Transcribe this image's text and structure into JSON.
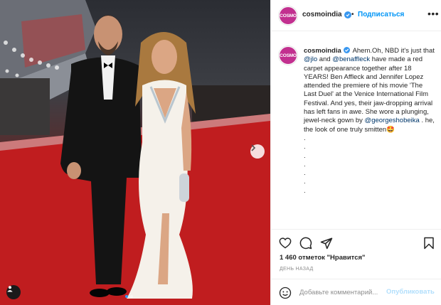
{
  "post": {
    "photo": {
      "dots": 2,
      "active_dot": 0,
      "next_icon": "chevron-right-icon",
      "tag_icon": "user-tag-icon"
    },
    "header": {
      "avatar_text": "COSMO",
      "username": "cosmoindia",
      "separator": "•",
      "follow_label": "Подписаться",
      "more_label": "•••"
    },
    "caption": {
      "avatar_text": "COSMO",
      "username": "cosmoindia",
      "text_1": "Ahem.Oh, NBD it's just that ",
      "mention_1": "@jlo",
      "text_2": " and ",
      "mention_2": "@benaffleck",
      "text_3": " have made a red carpet appearance together after 18 YEARS! Ben Affleck and Jennifer Lopez attended the premiere of his movie 'The Last Duel' at the Venice International Film Festival. And yes, their jaw-dropping arrival has left fans in awe. She wore a plunging, jewel-neck gown by ",
      "mention_3": "@georgeshobeika",
      "text_4": " . he, the look of one truly smitten",
      "emoji": "🤩",
      "dot_lines": [
        ".",
        ".",
        ".",
        ".",
        ".",
        ".",
        "."
      ]
    },
    "actions": {
      "like_icon": "heart-icon",
      "comment_icon": "comment-icon",
      "share_icon": "share-icon",
      "save_icon": "bookmark-icon"
    },
    "likes": {
      "count": "1 460",
      "text": "отметок \"Нравится\""
    },
    "date": "ДЕНЬ НАЗАД",
    "comment": {
      "placeholder": "Добавьте комментарий...",
      "publish_label": "Опубликовать"
    },
    "colors": {
      "accent": "#0095f6",
      "verified": "#3897f0",
      "brand_avatar": "#c2308f",
      "carpet": "#c01d1f"
    }
  }
}
